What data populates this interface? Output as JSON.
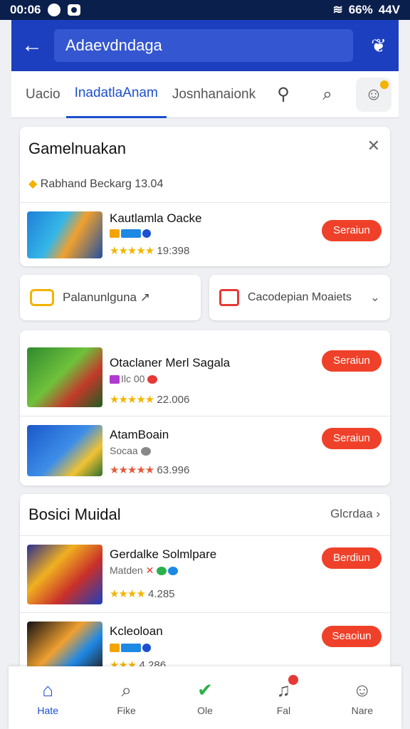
{
  "status_bar": {
    "time": "00:06",
    "battery": "66%",
    "signal": "44V"
  },
  "app_bar": {
    "search_value": "Adaevdndaga"
  },
  "tabs": [
    "Uacio",
    "InadatlaAnam",
    "Josnhanaionk"
  ],
  "featured": {
    "title": "Gamelnuakan",
    "subtitle": "Rabhand Beckarg 13.04",
    "app": {
      "name": "Kautlamla Oacke",
      "rating_text": "19:398",
      "install_label": "Seraiun"
    }
  },
  "quick_links": [
    {
      "label": "Palanunlguna ↗",
      "icon": "gamepad-icon"
    },
    {
      "label": "Cacodepian Moaiets",
      "icon": "store-icon"
    }
  ],
  "list_apps": [
    {
      "name": "Otaclaner Merl Sagala",
      "sub": "Ilc 00",
      "rating_text": "22.006",
      "install_label": "Seraiun"
    },
    {
      "name": "AtamBoain",
      "sub": "Socaa",
      "rating_text": "63.996",
      "install_label": "Seraiun"
    }
  ],
  "section": {
    "title": "Bosici Muidal",
    "action_label": "Glcrdaa",
    "apps": [
      {
        "name": "Gerdalke Solmlpare",
        "sub": "Matden",
        "rating_text": "4.285",
        "install_label": "Berdiun"
      },
      {
        "name": "Kcleoloan",
        "sub": "",
        "rating_text": "4.286",
        "install_label": "Seaoiun"
      }
    ]
  },
  "bottom_nav": [
    {
      "label": "Hate",
      "icon": "home-icon"
    },
    {
      "label": "Fike",
      "icon": "search-icon"
    },
    {
      "label": "Ole",
      "icon": "check-circle-icon"
    },
    {
      "label": "Fal",
      "icon": "bell-icon"
    },
    {
      "label": "Nare",
      "icon": "person-icon"
    }
  ],
  "colors": {
    "primary": "#1c3fbf",
    "accent": "#ef4129",
    "status_bar": "#0b1f4d"
  }
}
